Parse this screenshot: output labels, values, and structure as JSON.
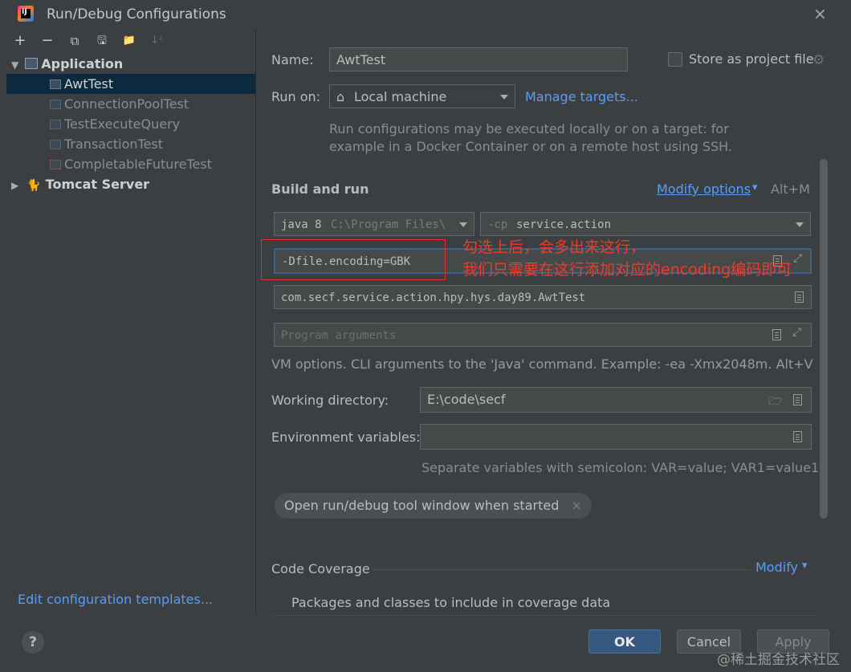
{
  "window": {
    "title": "Run/Debug Configurations",
    "close_glyph": "×"
  },
  "toolbar": {
    "add": "+",
    "remove": "−",
    "copy": "⧉",
    "save": "🖫",
    "folder": "📁",
    "sort": "↓ᶻ"
  },
  "tree": {
    "application": "Application",
    "items": [
      "AwtTest",
      "ConnectionPoolTest",
      "TestExecuteQuery",
      "TransactionTest",
      "CompletableFutureTest"
    ],
    "tomcat": "Tomcat Server"
  },
  "edit_templates": "Edit configuration templates...",
  "form": {
    "name_label": "Name:",
    "name_value": "AwtTest",
    "store_label": "Store as project file",
    "run_on_label": "Run on:",
    "run_on_value": "Local machine",
    "manage_targets": "Manage targets...",
    "run_on_hint_1": "Run configurations may be executed locally or on a target: for",
    "run_on_hint_2": "example in a Docker Container or on a remote host using SSH.",
    "build_and_run": "Build and run",
    "modify_options": "Modify options",
    "modify_shortcut": "Alt+M",
    "jre_name": "java 8",
    "jre_path": "C:\\Program Files\\",
    "cp_flag": "-cp",
    "cp_value": "service.action",
    "vm_options": "-Dfile.encoding=GBK",
    "main_class": "com.secf.service.action.hpy.hys.day89.AwtTest",
    "program_args_placeholder": "Program arguments",
    "vm_hint": "VM options. CLI arguments to the 'Java' command. Example: -ea -Xmx2048m. Alt+V",
    "working_dir_label": "Working directory:",
    "working_dir_value": "E:\\code\\secf",
    "env_label": "Environment variables:",
    "env_value": "",
    "env_hint": "Separate variables with semicolon: VAR=value; VAR1=value1",
    "open_tool_window": "Open run/debug tool window when started",
    "code_coverage": "Code Coverage",
    "modify": "Modify",
    "packages_hint": "Packages and classes to include in coverage data"
  },
  "buttons": {
    "ok": "OK",
    "cancel": "Cancel",
    "apply": "Apply",
    "help": "?"
  },
  "annotation": {
    "line1": "勾选上后，会多出来这行，",
    "line2": "我们只需要在这行添加对应的encoding编码即可"
  },
  "watermark": "@稀土掘金技术社区",
  "colors": {
    "background": "#3c3f41",
    "link": "#589df6",
    "selection": "#0d293e",
    "annotation": "#f03a2e",
    "primary_button": "#365880"
  }
}
